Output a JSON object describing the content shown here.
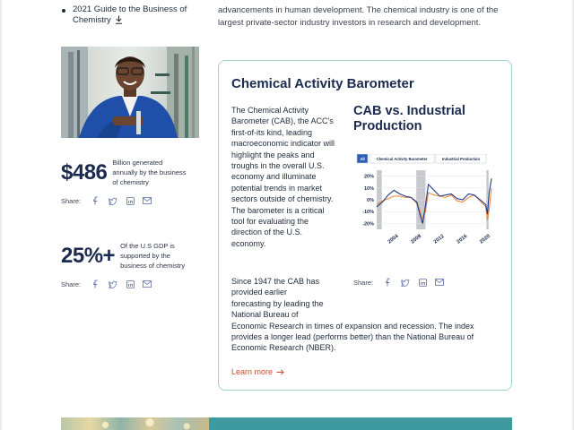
{
  "sidebar": {
    "resource_item": "2021 Guide to the Business of Chemistry",
    "stats": [
      {
        "value": "$486",
        "description": "Billion generated annually by the business of chemistry",
        "share_label": "Share:"
      },
      {
        "value": "25%+",
        "description": "Of the U.S GDP is supported by the business of chemistry",
        "share_label": "Share:"
      }
    ]
  },
  "intro": {
    "text": "advancements in human development. The chemical industry is one of the largest private-sector industry investors in research and development."
  },
  "card": {
    "title": "Chemical Activity Barometer",
    "paragraph1": "The Chemical Activity Barometer (CAB), the ACC's first-of-its kind, leading macroeconomic indicator will highlight the peaks and troughs in the overall U.S. economy and illuminate potential trends in market sectors outside of chemistry. The barometer is a critical tool for evaluating the direction of the U.S. economy.",
    "paragraph2_lines": [
      "Since 1947 the CAB has",
      "provided earlier",
      "forecasting by leading the",
      "National Bureau of",
      "Economic Research in times of expansion and recession. The index",
      "provides a longer lead (performs better) than the National Bureau of",
      "Economic Research (NBER)."
    ],
    "learn_more": "Learn more",
    "chart_title": "CAB vs. Industrial Production",
    "share_label": "Share:"
  },
  "colors": {
    "navy": "#1b2a4e",
    "accent_orange": "#d04a2f",
    "card_border": "#9fd3d1",
    "teal_banner": "#3e9aa0",
    "series_cab": "#1f3a8a",
    "series_ip": "#f08a3c"
  },
  "chart_data": {
    "type": "line",
    "legend": [
      "All",
      "Chemical Activity Barometer",
      "Industrial Production"
    ],
    "x_ticks": [
      "2004",
      "2008",
      "2012",
      "2016",
      "2020"
    ],
    "y_ticks": [
      "20%",
      "10%",
      "0%",
      "-10%",
      "-20%"
    ],
    "ylim": [
      -25,
      25
    ],
    "xlim": [
      2001,
      2021
    ],
    "recessions": [
      [
        2001,
        2001.9
      ],
      [
        2007.9,
        2009.5
      ],
      [
        2020.1,
        2020.5
      ]
    ],
    "series": [
      {
        "name": "Chemical Activity Barometer",
        "x": [
          2001,
          2002,
          2003,
          2004,
          2005,
          2006,
          2007,
          2008,
          2008.5,
          2009,
          2009.5,
          2010,
          2011,
          2012,
          2013,
          2014,
          2015,
          2016,
          2017,
          2018,
          2019,
          2020,
          2020.3,
          2020.6,
          2021
        ],
        "y": [
          -6,
          -2,
          4,
          8,
          5,
          3,
          2,
          -2,
          -12,
          -20,
          -5,
          13,
          8,
          3,
          4,
          5,
          1,
          0,
          5,
          4,
          0,
          -4,
          -12,
          6,
          18
        ]
      },
      {
        "name": "Industrial Production",
        "x": [
          2001,
          2002,
          2003,
          2004,
          2005,
          2006,
          2007,
          2008,
          2008.5,
          2009,
          2009.5,
          2010,
          2011,
          2012,
          2013,
          2014,
          2015,
          2016,
          2017,
          2018,
          2019,
          2020,
          2020.3,
          2020.6,
          2021
        ],
        "y": [
          -4,
          -1,
          1,
          3,
          3,
          2,
          2,
          -3,
          -9,
          -16,
          -10,
          6,
          4,
          3,
          2,
          4,
          -1,
          -2,
          2,
          4,
          -1,
          -6,
          -17,
          -8,
          10
        ]
      }
    ]
  }
}
